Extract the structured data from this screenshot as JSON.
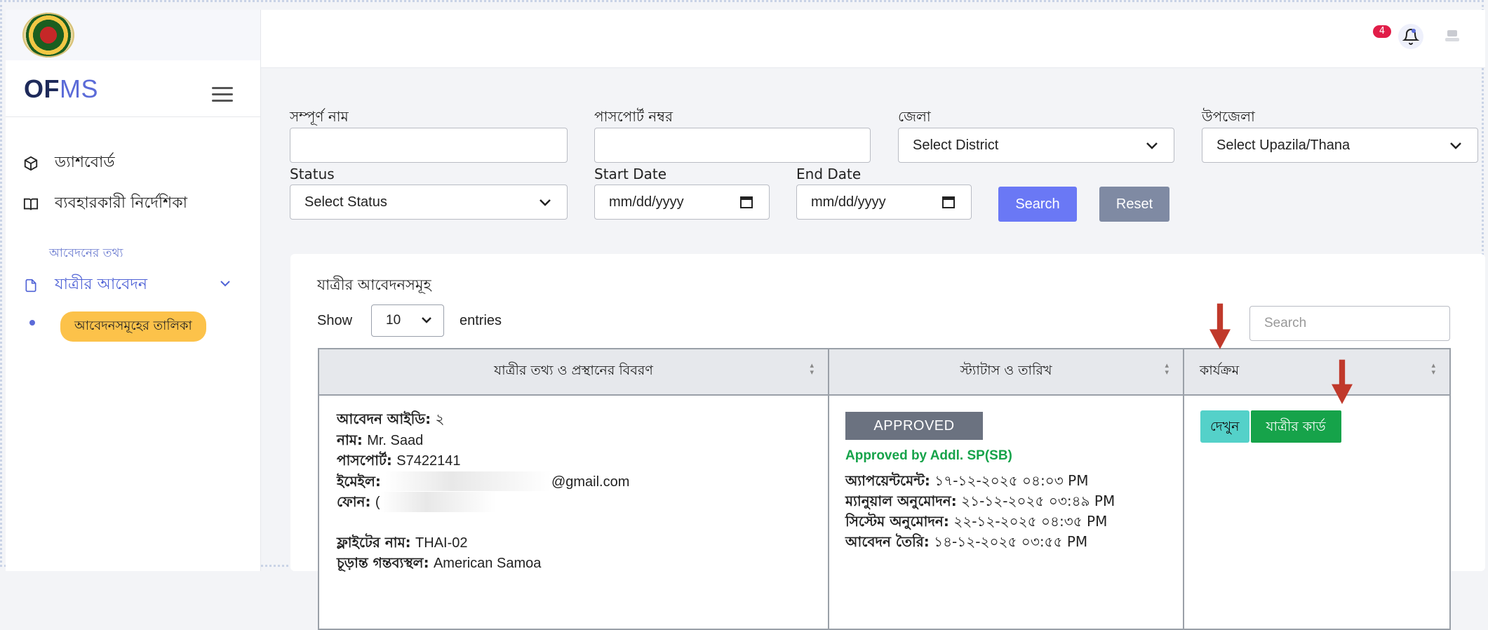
{
  "app": {
    "brand_part1": "OF",
    "brand_part2": "MS"
  },
  "sidebar": {
    "items": [
      {
        "label": "ড্যাশবোর্ড",
        "icon": "cube-icon"
      },
      {
        "label": "ব্যবহারকারী নির্দেশিকা",
        "icon": "book-icon"
      }
    ],
    "section_label": "আবেদনের তথ্য",
    "apps_menu": {
      "label": "যাত্রীর আবেদন",
      "icon": "document-icon"
    },
    "sub_active": "আবেদনসমূহের তালিকা"
  },
  "header": {
    "notification_count": "4"
  },
  "filters": {
    "full_name_label": "সম্পূর্ণ নাম",
    "passport_label": "পাসপোর্ট নম্বর",
    "district_label": "জেলা",
    "district_value": "Select District",
    "upazila_label": "উপজেলা",
    "upazila_value": "Select Upazila/Thana",
    "status_label": "Status",
    "status_value": "Select Status",
    "start_date_label": "Start Date",
    "start_date_value": "mm/dd/yyyy",
    "end_date_label": "End Date",
    "end_date_value": "mm/dd/yyyy",
    "search_button": "Search",
    "reset_button": "Reset"
  },
  "table": {
    "title": "যাত্রীর আবেদনসমূহ",
    "show_label": "Show",
    "page_size": "10",
    "entries_label": "entries",
    "search_placeholder": "Search",
    "columns": [
      "যাত্রীর তথ্য ও প্রস্থানের বিবরণ",
      "স্ট্যাটাস ও তারিখ",
      "কার্যক্রম"
    ],
    "rows": [
      {
        "id_label": "আবেদন আইডি:",
        "id_value": "২",
        "name_label": "নাম:",
        "name_value": "Mr. Saad",
        "passport_label": "পাসপোর্ট:",
        "passport_value": "S7422141",
        "email_label": "ইমেইল:",
        "email_value": "@gmail.com",
        "phone_label": "ফোন:",
        "phone_value": "(",
        "flight_label": "ফ্লাইটের নাম:",
        "flight_value": "THAI-02",
        "destination_label": "চূড়ান্ত গন্তব্যস্থল:",
        "destination_value": "American Samoa",
        "status_badge": "APPROVED",
        "approved_by": "Approved by Addl. SP(SB)",
        "appointment_label": "অ্যাপয়েন্টমেন্ট:",
        "appointment_value": "১৭-১২-২০২৫ ০৪:০৩ PM",
        "manual_label": "ম্যানুয়াল অনুমোদন:",
        "manual_value": "২১-১২-২০২৫ ০৩:৪৯ PM",
        "system_label": "সিস্টেম অনুমোদন:",
        "system_value": "২২-১২-২০২৫ ০৪:৩৫ PM",
        "created_label": "আবেদন তৈরি:",
        "created_value": "১৪-১২-২০২৫ ০৩:৫৫ PM",
        "view_button": "দেখুন",
        "card_button": "যাত্রীর কার্ড"
      }
    ]
  },
  "colors": {
    "accent": "#6a78f5",
    "active_pill": "#fcc24a",
    "approved_text": "#16a34a",
    "annotation_arrow": "#c0392b"
  }
}
